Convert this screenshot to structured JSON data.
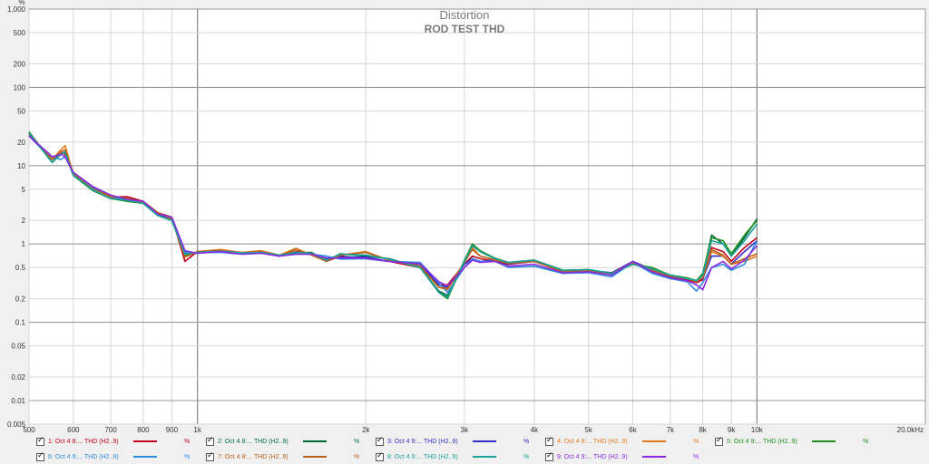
{
  "chart_data": {
    "type": "line",
    "title": "Distortion",
    "subtitle": "ROD TEST THD",
    "ylabel": "%",
    "xunit": "Hz",
    "xscale": "log",
    "yscale": "log",
    "xlim": [
      500,
      20000
    ],
    "ylim": [
      0.005,
      1000
    ],
    "grid": true,
    "xticks": [
      {
        "v": 500,
        "label": "500"
      },
      {
        "v": 600,
        "label": "600"
      },
      {
        "v": 700,
        "label": "700"
      },
      {
        "v": 800,
        "label": "800"
      },
      {
        "v": 900,
        "label": "900"
      },
      {
        "v": 1000,
        "label": "1k"
      },
      {
        "v": 2000,
        "label": "2k"
      },
      {
        "v": 3000,
        "label": "3k"
      },
      {
        "v": 4000,
        "label": "4k"
      },
      {
        "v": 5000,
        "label": "5k"
      },
      {
        "v": 6000,
        "label": "6k"
      },
      {
        "v": 7000,
        "label": "7k"
      },
      {
        "v": 8000,
        "label": "8k"
      },
      {
        "v": 9000,
        "label": "9k"
      },
      {
        "v": 10000,
        "label": "10k"
      },
      {
        "v": 20000,
        "label": "20.0kHz"
      }
    ],
    "yticks": [
      {
        "v": 1000,
        "label": "1,000"
      },
      {
        "v": 500,
        "label": "500"
      },
      {
        "v": 200,
        "label": "200"
      },
      {
        "v": 100,
        "label": "100"
      },
      {
        "v": 50,
        "label": "50"
      },
      {
        "v": 20,
        "label": "20"
      },
      {
        "v": 10,
        "label": "10"
      },
      {
        "v": 5,
        "label": "5"
      },
      {
        "v": 2,
        "label": "2"
      },
      {
        "v": 1,
        "label": "1"
      },
      {
        "v": 0.5,
        "label": "0.5"
      },
      {
        "v": 0.2,
        "label": "0.2"
      },
      {
        "v": 0.1,
        "label": "0.1"
      },
      {
        "v": 0.05,
        "label": "0.05"
      },
      {
        "v": 0.02,
        "label": "0.02"
      },
      {
        "v": 0.01,
        "label": "0.01"
      },
      {
        "v": 0.005,
        "label": "0.005"
      }
    ],
    "x": [
      500,
      550,
      570,
      580,
      600,
      650,
      700,
      750,
      800,
      850,
      900,
      950,
      1000,
      1100,
      1200,
      1300,
      1400,
      1500,
      1600,
      1700,
      1800,
      2000,
      2200,
      2500,
      2700,
      2800,
      3000,
      3100,
      3200,
      3400,
      3600,
      4000,
      4500,
      5000,
      5500,
      6000,
      6500,
      7000,
      7500,
      7800,
      8000,
      8300,
      8700,
      9000,
      9500,
      10000
    ],
    "series": [
      {
        "name": "1: Oct 4 8:... THD (H2..9)",
        "unit": "%",
        "color": "#c0001a",
        "values": [
          25,
          12,
          15,
          14,
          8,
          5,
          4,
          4,
          3.5,
          2.5,
          2.2,
          0.6,
          0.8,
          0.8,
          0.75,
          0.8,
          0.7,
          0.8,
          0.75,
          0.6,
          0.7,
          0.65,
          0.6,
          0.5,
          0.3,
          0.3,
          0.55,
          0.7,
          0.65,
          0.6,
          0.55,
          0.6,
          0.45,
          0.45,
          0.42,
          0.6,
          0.45,
          0.38,
          0.35,
          0.32,
          0.35,
          0.9,
          0.8,
          0.6,
          0.9,
          1.2
        ]
      },
      {
        "name": "2: Oct 4 8:... THD (H2..9)",
        "unit": "%",
        "color": "#006a3a",
        "values": [
          26,
          11,
          14,
          15,
          7.5,
          4.8,
          3.8,
          3.6,
          3.3,
          2.3,
          2.0,
          0.75,
          0.78,
          0.82,
          0.78,
          0.78,
          0.72,
          0.78,
          0.78,
          0.6,
          0.75,
          0.7,
          0.65,
          0.5,
          0.25,
          0.22,
          0.6,
          0.95,
          0.8,
          0.65,
          0.58,
          0.62,
          0.46,
          0.47,
          0.42,
          0.55,
          0.48,
          0.4,
          0.36,
          0.34,
          0.4,
          1.3,
          1.0,
          0.7,
          1.2,
          2.1
        ]
      },
      {
        "name": "3: Oct 4 9:... THD (H2..9)",
        "unit": "%",
        "color": "#3030c8",
        "values": [
          24,
          12,
          14,
          13,
          8,
          5.2,
          3.9,
          3.7,
          3.4,
          2.4,
          2.1,
          0.8,
          0.76,
          0.8,
          0.75,
          0.78,
          0.7,
          0.76,
          0.74,
          0.65,
          0.68,
          0.68,
          0.6,
          0.55,
          0.3,
          0.28,
          0.55,
          0.65,
          0.6,
          0.62,
          0.56,
          0.6,
          0.45,
          0.46,
          0.43,
          0.6,
          0.47,
          0.39,
          0.36,
          0.34,
          0.36,
          0.7,
          0.7,
          0.55,
          0.8,
          1.1
        ]
      },
      {
        "name": "4: Oct 4 9:... THD (H2..9)",
        "unit": "%",
        "color": "#e37a1e",
        "values": [
          25,
          12,
          16,
          18,
          7.8,
          5.0,
          4.0,
          3.8,
          3.4,
          2.5,
          2.1,
          0.7,
          0.8,
          0.85,
          0.78,
          0.82,
          0.72,
          0.88,
          0.72,
          0.62,
          0.72,
          0.8,
          0.62,
          0.52,
          0.28,
          0.26,
          0.58,
          0.9,
          0.7,
          0.63,
          0.57,
          0.6,
          0.44,
          0.46,
          0.42,
          0.58,
          0.46,
          0.39,
          0.36,
          0.33,
          0.37,
          0.8,
          0.7,
          0.55,
          0.6,
          0.7
        ]
      },
      {
        "name": "5: Oct 4 9:... THD (H2..9)",
        "unit": "%",
        "color": "#1d8f1d",
        "values": [
          27,
          11,
          14,
          15,
          7.6,
          4.8,
          3.8,
          3.5,
          3.3,
          2.3,
          2.0,
          0.72,
          0.78,
          0.8,
          0.77,
          0.79,
          0.72,
          0.78,
          0.75,
          0.62,
          0.74,
          0.72,
          0.64,
          0.5,
          0.24,
          0.2,
          0.62,
          1.0,
          0.82,
          0.66,
          0.58,
          0.62,
          0.46,
          0.47,
          0.42,
          0.55,
          0.5,
          0.4,
          0.37,
          0.34,
          0.42,
          1.2,
          1.1,
          0.75,
          1.3,
          2.0
        ]
      },
      {
        "name": "6: Oct 4 9:... THD (H2..9)",
        "unit": "%",
        "color": "#2f8be0",
        "values": [
          24,
          13,
          12,
          13,
          8.2,
          5.3,
          4.1,
          3.6,
          3.4,
          2.4,
          2.2,
          0.78,
          0.77,
          0.78,
          0.74,
          0.76,
          0.7,
          0.74,
          0.74,
          0.7,
          0.64,
          0.65,
          0.6,
          0.58,
          0.32,
          0.24,
          0.5,
          0.65,
          0.6,
          0.6,
          0.5,
          0.52,
          0.42,
          0.43,
          0.38,
          0.58,
          0.42,
          0.36,
          0.33,
          0.25,
          0.32,
          0.5,
          0.55,
          0.46,
          0.55,
          1.1
        ]
      },
      {
        "name": "7: Oct 4 8:... THD (H2..9)",
        "unit": "%",
        "color": "#b8621c",
        "values": [
          25,
          12,
          15,
          16,
          7.9,
          5.0,
          4.1,
          3.8,
          3.4,
          2.5,
          2.1,
          0.68,
          0.8,
          0.82,
          0.77,
          0.8,
          0.7,
          0.85,
          0.72,
          0.6,
          0.72,
          0.78,
          0.62,
          0.52,
          0.28,
          0.27,
          0.58,
          0.85,
          0.7,
          0.62,
          0.57,
          0.6,
          0.44,
          0.46,
          0.42,
          0.58,
          0.46,
          0.39,
          0.36,
          0.33,
          0.37,
          0.85,
          0.72,
          0.55,
          0.65,
          0.75
        ]
      },
      {
        "name": "8: Oct 4 9:... THD (H2..9)",
        "unit": "%",
        "color": "#1aa39a",
        "values": [
          26,
          11,
          14,
          15,
          7.6,
          4.9,
          3.8,
          3.6,
          3.3,
          2.3,
          2.0,
          0.74,
          0.78,
          0.81,
          0.77,
          0.78,
          0.72,
          0.78,
          0.76,
          0.62,
          0.74,
          0.72,
          0.64,
          0.5,
          0.24,
          0.21,
          0.6,
          0.95,
          0.8,
          0.65,
          0.58,
          0.62,
          0.46,
          0.47,
          0.42,
          0.55,
          0.48,
          0.4,
          0.36,
          0.34,
          0.4,
          1.1,
          1.0,
          0.7,
          1.1,
          1.8
        ]
      },
      {
        "name": "9: Oct 4 9:... THD (H2..9)",
        "unit": "%",
        "color": "#8a2be2",
        "values": [
          24,
          13,
          14,
          13,
          8.2,
          5.4,
          4.2,
          3.7,
          3.5,
          2.4,
          2.2,
          0.82,
          0.76,
          0.8,
          0.74,
          0.76,
          0.7,
          0.74,
          0.74,
          0.66,
          0.66,
          0.66,
          0.6,
          0.56,
          0.33,
          0.29,
          0.5,
          0.62,
          0.58,
          0.6,
          0.52,
          0.55,
          0.43,
          0.44,
          0.4,
          0.6,
          0.44,
          0.37,
          0.34,
          0.3,
          0.26,
          0.5,
          0.6,
          0.48,
          0.62,
          0.95
        ]
      }
    ]
  }
}
